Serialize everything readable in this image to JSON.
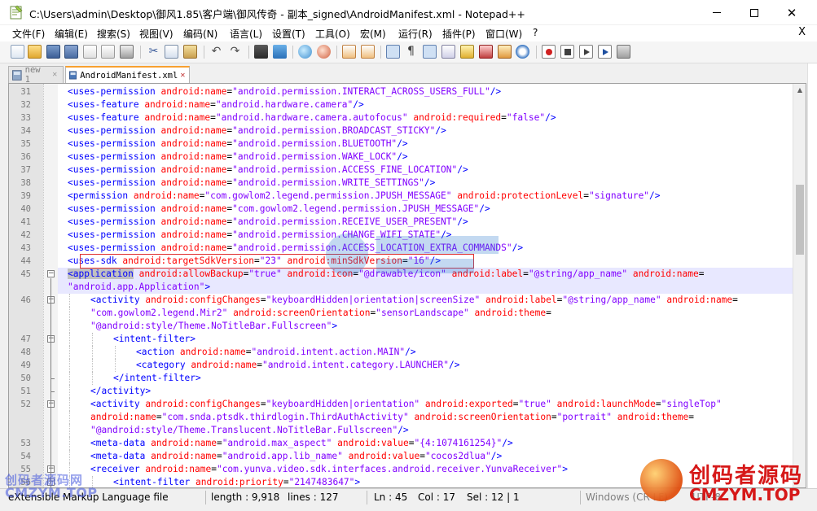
{
  "window": {
    "title": "C:\\Users\\admin\\Desktop\\御风1.85\\客户端\\御风传奇 - 副本_signed\\AndroidManifest.xml - Notepad++",
    "minimize_label": "—",
    "maximize_label": "☐",
    "close_label": "✕"
  },
  "menu": {
    "items": [
      "文件(F)",
      "编辑(E)",
      "搜索(S)",
      "视图(V)",
      "编码(N)",
      "语言(L)",
      "设置(T)",
      "工具(O)",
      "宏(M)",
      "运行(R)",
      "插件(P)",
      "窗口(W)",
      "?"
    ],
    "close_label": "X"
  },
  "tabs": [
    {
      "label": "new 1",
      "active": false
    },
    {
      "label": "AndroidManifest.xml",
      "active": true
    }
  ],
  "editor": {
    "current_line": 45,
    "lines": [
      {
        "n": "31",
        "fold": "",
        "indent": 1,
        "text": "<uses-permission android:name=\"android.permission.INTERACT_ACROSS_USERS_FULL\"/>"
      },
      {
        "n": "32",
        "fold": "",
        "indent": 1,
        "text": "<uses-feature android:name=\"android.hardware.camera\"/>"
      },
      {
        "n": "33",
        "fold": "",
        "indent": 1,
        "text": "<uses-feature android:name=\"android.hardware.camera.autofocus\" android:required=\"false\"/>"
      },
      {
        "n": "34",
        "fold": "",
        "indent": 1,
        "text": "<uses-permission android:name=\"android.permission.BROADCAST_STICKY\"/>"
      },
      {
        "n": "35",
        "fold": "",
        "indent": 1,
        "text": "<uses-permission android:name=\"android.permission.BLUETOOTH\"/>"
      },
      {
        "n": "36",
        "fold": "",
        "indent": 1,
        "text": "<uses-permission android:name=\"android.permission.WAKE_LOCK\"/>"
      },
      {
        "n": "37",
        "fold": "",
        "indent": 1,
        "text": "<uses-permission android:name=\"android.permission.ACCESS_FINE_LOCATION\"/>"
      },
      {
        "n": "38",
        "fold": "",
        "indent": 1,
        "text": "<uses-permission android:name=\"android.permission.WRITE_SETTINGS\"/>"
      },
      {
        "n": "39",
        "fold": "",
        "indent": 1,
        "text": "<permission android:name=\"com.gowlom2.legend.permission.JPUSH_MESSAGE\" android:protectionLevel=\"signature\"/>"
      },
      {
        "n": "40",
        "fold": "",
        "indent": 1,
        "text": "<uses-permission android:name=\"com.gowlom2.legend.permission.JPUSH_MESSAGE\"/>"
      },
      {
        "n": "41",
        "fold": "",
        "indent": 1,
        "text": "<uses-permission android:name=\"android.permission.RECEIVE_USER_PRESENT\"/>"
      },
      {
        "n": "42",
        "fold": "",
        "indent": 1,
        "text": "<uses-permission android:name=\"android.permission.CHANGE_WIFI_STATE\"/>"
      },
      {
        "n": "43",
        "fold": "",
        "indent": 1,
        "text": "<uses-permission android:name=\"android.permission.ACCESS_LOCATION_EXTRA_COMMANDS\"/>"
      },
      {
        "n": "44",
        "fold": "",
        "indent": 1,
        "text": "<uses-sdk android:targetSdkVersion=\"23\" android:minSdkVersion=\"16\"/>"
      },
      {
        "n": "45",
        "fold": "minus",
        "indent": 1,
        "text": "<application android:allowBackup=\"true\" android:icon=\"@drawable/icon\" android:label=\"@string/app_name\" android:name="
      },
      {
        "n": "",
        "fold": "",
        "indent": 1,
        "text": "\"android.app.Application\">"
      },
      {
        "n": "46",
        "fold": "minus",
        "indent": 2,
        "text": "<activity android:configChanges=\"keyboardHidden|orientation|screenSize\" android:label=\"@string/app_name\" android:name="
      },
      {
        "n": "",
        "fold": "",
        "indent": 2,
        "text": "\"com.gowlom2.legend.Mir2\" android:screenOrientation=\"sensorLandscape\" android:theme="
      },
      {
        "n": "",
        "fold": "",
        "indent": 2,
        "text": "\"@android:style/Theme.NoTitleBar.Fullscreen\">"
      },
      {
        "n": "47",
        "fold": "minus",
        "indent": 3,
        "text": "<intent-filter>"
      },
      {
        "n": "48",
        "fold": "",
        "indent": 4,
        "text": "<action android:name=\"android.intent.action.MAIN\"/>"
      },
      {
        "n": "49",
        "fold": "",
        "indent": 4,
        "text": "<category android:name=\"android.intent.category.LAUNCHER\"/>"
      },
      {
        "n": "50",
        "fold": "end",
        "indent": 3,
        "text": "</intent-filter>"
      },
      {
        "n": "51",
        "fold": "end",
        "indent": 2,
        "text": "</activity>"
      },
      {
        "n": "52",
        "fold": "minus",
        "indent": 2,
        "text": "<activity android:configChanges=\"keyboardHidden|orientation\" android:exported=\"true\" android:launchMode=\"singleTop\""
      },
      {
        "n": "",
        "fold": "",
        "indent": 2,
        "text": "android:name=\"com.snda.ptsdk.thirdlogin.ThirdAuthActivity\" android:screenOrientation=\"portrait\" android:theme="
      },
      {
        "n": "",
        "fold": "",
        "indent": 2,
        "text": "\"@android:style/Theme.Translucent.NoTitleBar.Fullscreen\"/>"
      },
      {
        "n": "53",
        "fold": "",
        "indent": 2,
        "text": "<meta-data android:name=\"android.max_aspect\" android:value=\"{4:1074161254}\"/>"
      },
      {
        "n": "54",
        "fold": "",
        "indent": 2,
        "text": "<meta-data android:name=\"android.app.lib_name\" android:value=\"cocos2dlua\"/>"
      },
      {
        "n": "55",
        "fold": "minus",
        "indent": 2,
        "text": "<receiver android:name=\"com.yunva.video.sdk.interfaces.android.receiver.YunvaReceiver\">"
      },
      {
        "n": "56",
        "fold": "minus",
        "indent": 3,
        "text": "<intent-filter android:priority=\"2147483647\">"
      }
    ]
  },
  "status": {
    "language": "eXtensible Markup Language file",
    "length": "length : 9,918",
    "lines": "lines : 127",
    "ln": "Ln : 45",
    "col": "Col : 17",
    "sel": "Sel : 12 | 1",
    "eol": "Windows (CR LF)",
    "encoding": "UTF-8"
  },
  "watermark": {
    "left_line1": "创码者源码网",
    "left_line2": "CMZYM.TOP",
    "right_cn": "创码者源码",
    "right_en": "CMZYM.TOP"
  },
  "colors": {
    "tag": "#0000ff",
    "attr": "#ff0000",
    "value": "#8000ff",
    "current_line": "#e8e8ff",
    "annotation_box": "#e03030",
    "watermark_red": "#d61818"
  }
}
